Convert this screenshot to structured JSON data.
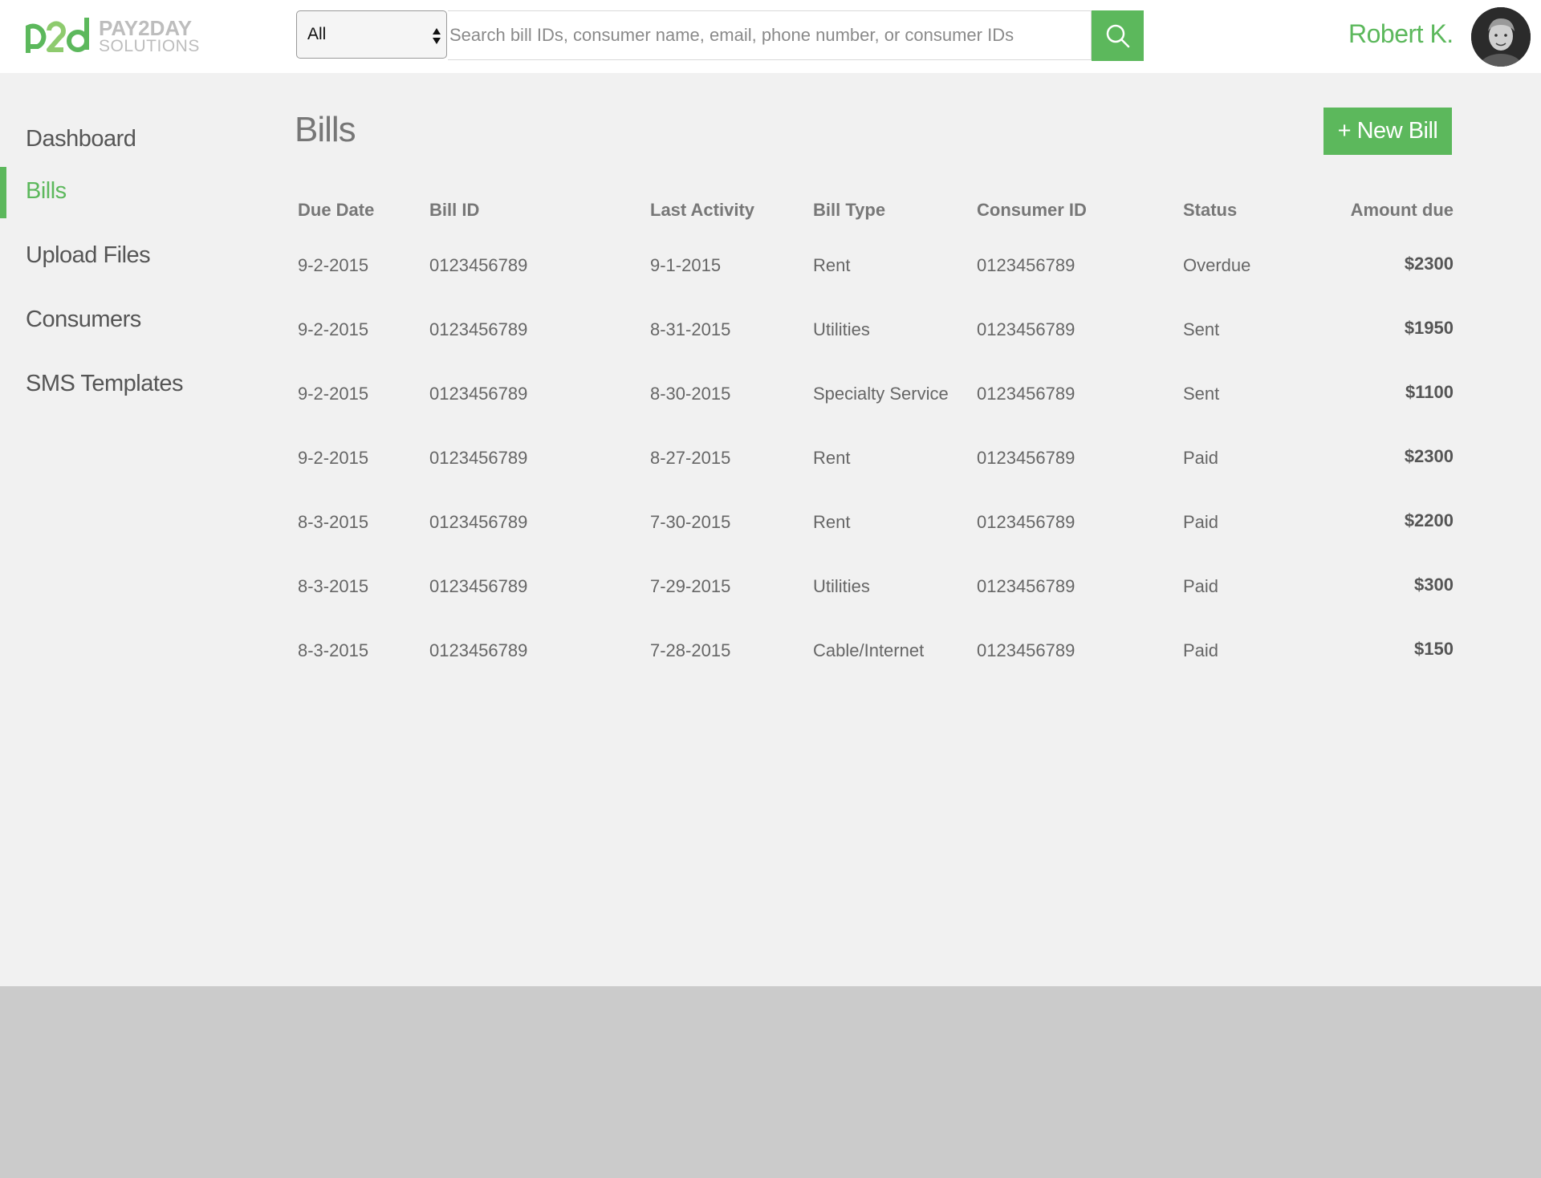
{
  "brand": {
    "logo_mark": "p2d",
    "name_line1": "PAY2DAY",
    "name_line2": "SOLUTIONS",
    "accent_color": "#5cb85c"
  },
  "search": {
    "filter_value": "All",
    "placeholder": "Search bill IDs, consumer name, email, phone number, or consumer IDs",
    "button_icon": "search-icon"
  },
  "user": {
    "name": "Robert K."
  },
  "sidebar": {
    "items": [
      {
        "label": "Dashboard",
        "active": false
      },
      {
        "label": "Bills",
        "active": true
      },
      {
        "label": "Upload Files",
        "active": false
      },
      {
        "label": "Consumers",
        "active": false
      },
      {
        "label": "SMS Templates",
        "active": false
      }
    ]
  },
  "main": {
    "title": "Bills",
    "new_bill_label": "+ New Bill"
  },
  "table": {
    "headers": [
      "Due Date",
      "Bill ID",
      "Last Activity",
      "Bill Type",
      "Consumer ID",
      "Status",
      "Amount due"
    ],
    "rows": [
      [
        "9-2-2015",
        "0123456789",
        "9-1-2015",
        "Rent",
        "0123456789",
        "Overdue",
        "$2300"
      ],
      [
        "9-2-2015",
        "0123456789",
        "8-31-2015",
        "Utilities",
        "0123456789",
        "Sent",
        "$1950"
      ],
      [
        "9-2-2015",
        "0123456789",
        "8-30-2015",
        "Specialty Service",
        "0123456789",
        "Sent",
        "$1100"
      ],
      [
        "9-2-2015",
        "0123456789",
        "8-27-2015",
        "Rent",
        "0123456789",
        "Paid",
        "$2300"
      ],
      [
        "8-3-2015",
        "0123456789",
        "7-30-2015",
        "Rent",
        "0123456789",
        "Paid",
        "$2200"
      ],
      [
        "8-3-2015",
        "0123456789",
        "7-29-2015",
        "Utilities",
        "0123456789",
        "Paid",
        "$300"
      ],
      [
        "8-3-2015",
        "0123456789",
        "7-28-2015",
        "Cable/Internet",
        "0123456789",
        "Paid",
        "$150"
      ]
    ]
  }
}
